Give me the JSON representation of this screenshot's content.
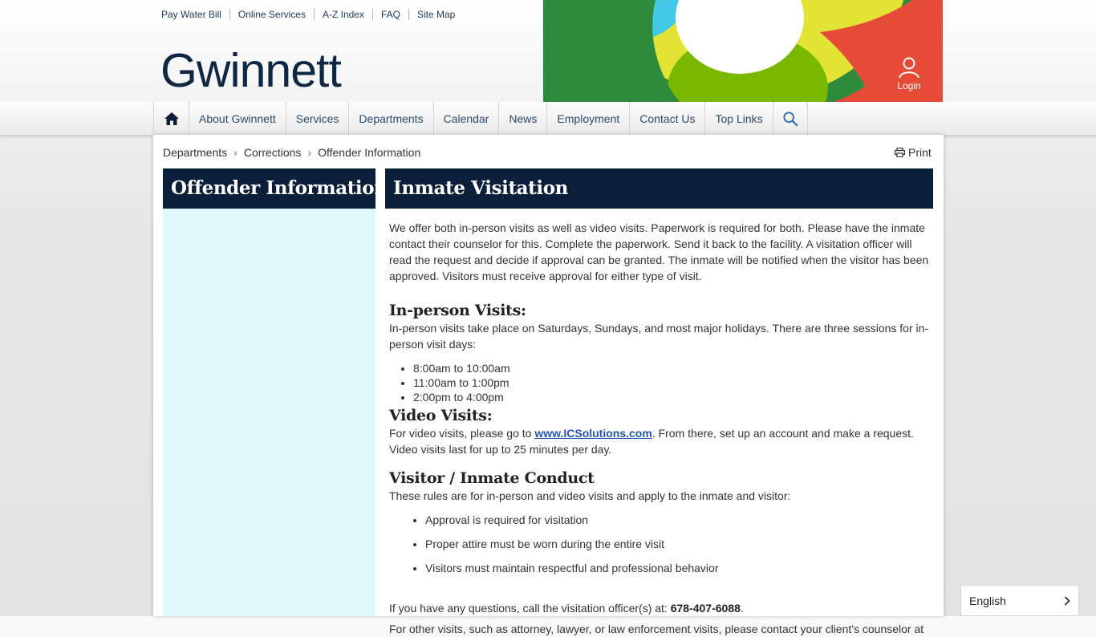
{
  "utility_links": [
    "Pay Water Bill",
    "Online Services",
    "A-Z Index",
    "FAQ",
    "Site Map"
  ],
  "logo_text": "Gwinnett",
  "login_label": "Login",
  "nav": {
    "items": [
      "About Gwinnett",
      "Services",
      "Departments",
      "Calendar",
      "News",
      "Employment",
      "Contact Us",
      "Top Links"
    ]
  },
  "breadcrumb": [
    "Departments",
    "Corrections",
    "Offender Information"
  ],
  "print_label": "Print",
  "sidebar_title": "Offender Information",
  "page_title": "Inmate Visitation",
  "intro": "We offer both in-person visits as well as video visits. Paperwork is required for both. Please have the inmate contact their counselor for this. Complete the paperwork. Send it back to the facility. A visitation officer will read the request and decide if approval can be granted. The inmate will be notified when the visitor has been approved. Visitors must receive approval for either type of visit.",
  "in_person": {
    "heading": "In-person Visits:",
    "text": "In-person visits take place on Saturdays, Sundays, and most major holidays. There are three sessions for in-person visit days:",
    "sessions": [
      "8:00am to 10:00am",
      "11:00am to 1:00pm",
      "2:00pm to 4:00pm"
    ]
  },
  "video": {
    "heading": "Video Visits:",
    "text_before": "For video visits, please go to ",
    "link": "www.ICSolutions.com",
    "text_after": ". From there, set up an account and make a request. Video visits last for up to 25 minutes per day."
  },
  "conduct": {
    "heading": "Visitor / Inmate Conduct",
    "text": "These rules are for in-person and video visits and apply to the inmate and visitor:",
    "rules": [
      "Approval is required for visitation",
      "Proper attire must be worn during the entire visit",
      "Visitors must maintain respectful and professional behavior"
    ]
  },
  "questions": {
    "text": "If you have any questions, call the visitation officer(s) at: ",
    "phone": "678-407-6088",
    "end": "."
  },
  "partial_line": "For other visits, such as attorney, lawyer, or law enforcement visits, please contact your client's counselor at",
  "language": "English",
  "colors": {
    "navy": "#0b1f3a",
    "sidebar_bg": "#e0f7fb",
    "link": "#2552b5",
    "banner_green": "#2e8b3c",
    "banner_lime": "#7ab800",
    "banner_yellow": "#e2e335",
    "banner_red": "#e54b36",
    "banner_cyan": "#44c8e8"
  }
}
